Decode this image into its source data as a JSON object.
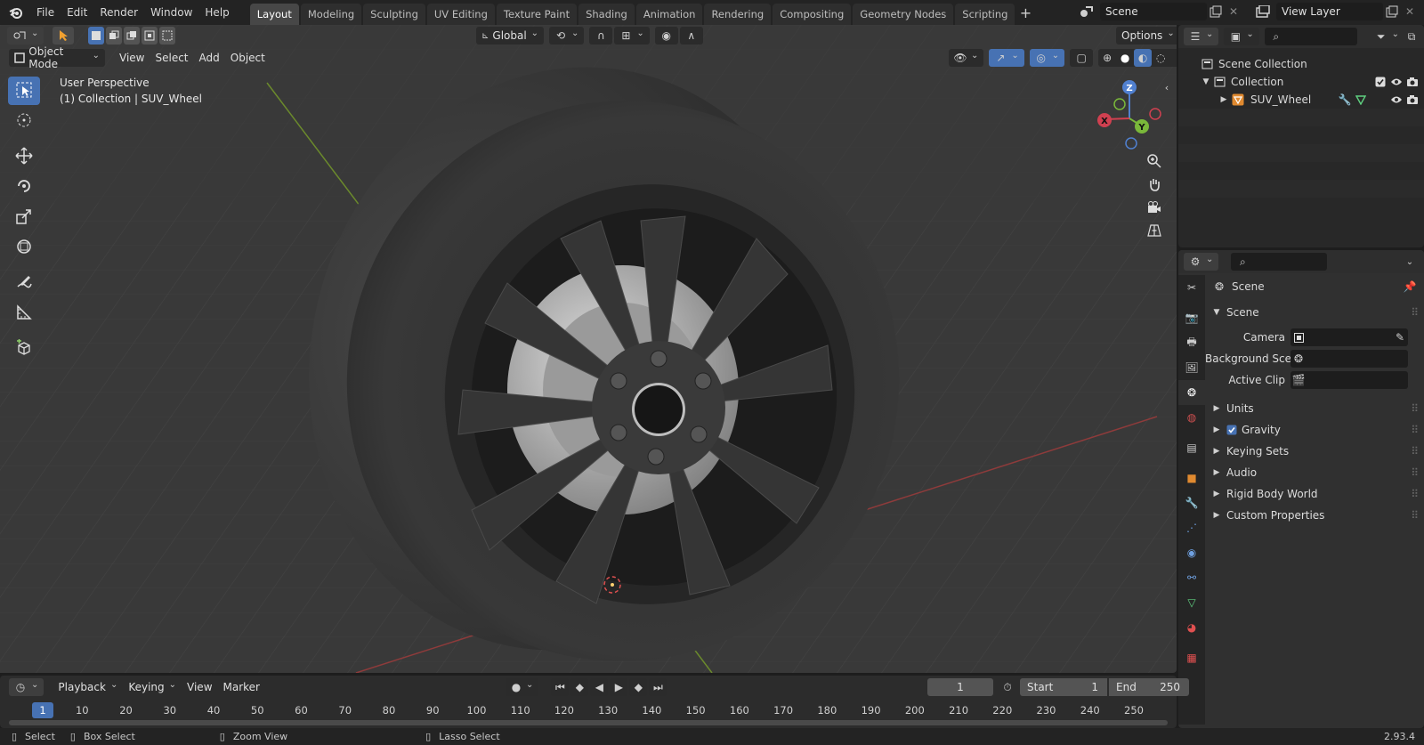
{
  "app": {
    "menus": [
      "File",
      "Edit",
      "Render",
      "Window",
      "Help"
    ],
    "workspaces": [
      "Layout",
      "Modeling",
      "Sculpting",
      "UV Editing",
      "Texture Paint",
      "Shading",
      "Animation",
      "Rendering",
      "Compositing",
      "Geometry Nodes",
      "Scripting"
    ],
    "active_workspace": "Layout",
    "scene_name": "Scene",
    "view_layer": "View Layer",
    "version": "2.93.4"
  },
  "viewport": {
    "orientation": "Global",
    "options_label": "Options",
    "mode": "Object Mode",
    "menus": [
      "View",
      "Select",
      "Add",
      "Object"
    ],
    "perspective_label": "User Perspective",
    "collection_label": "(1) Collection | SUV_Wheel",
    "gizmo": {
      "x": "X",
      "y": "Y",
      "z": "Z"
    }
  },
  "outliner": {
    "scene_collection": "Scene Collection",
    "collection": "Collection",
    "object": "SUV_Wheel"
  },
  "properties": {
    "context_title": "Scene",
    "panel_title": "Scene",
    "fields": {
      "camera_label": "Camera",
      "background_label": "Background Sce...",
      "active_clip_label": "Active Clip"
    },
    "subpanels": [
      "Units",
      "Gravity",
      "Keying Sets",
      "Audio",
      "Rigid Body World",
      "Custom Properties"
    ],
    "gravity_checked": true
  },
  "timeline": {
    "menus": [
      "Playback",
      "Keying",
      "View",
      "Marker"
    ],
    "current_frame": "1",
    "start_label": "Start",
    "start_value": "1",
    "end_label": "End",
    "end_value": "250",
    "ticks": [
      "1",
      "10",
      "20",
      "30",
      "40",
      "50",
      "60",
      "70",
      "80",
      "90",
      "100",
      "110",
      "120",
      "130",
      "140",
      "150",
      "160",
      "170",
      "180",
      "190",
      "200",
      "210",
      "220",
      "230",
      "240",
      "250"
    ]
  },
  "status": {
    "select": "Select",
    "box_select": "Box Select",
    "zoom_view": "Zoom View",
    "lasso_select": "Lasso Select"
  }
}
